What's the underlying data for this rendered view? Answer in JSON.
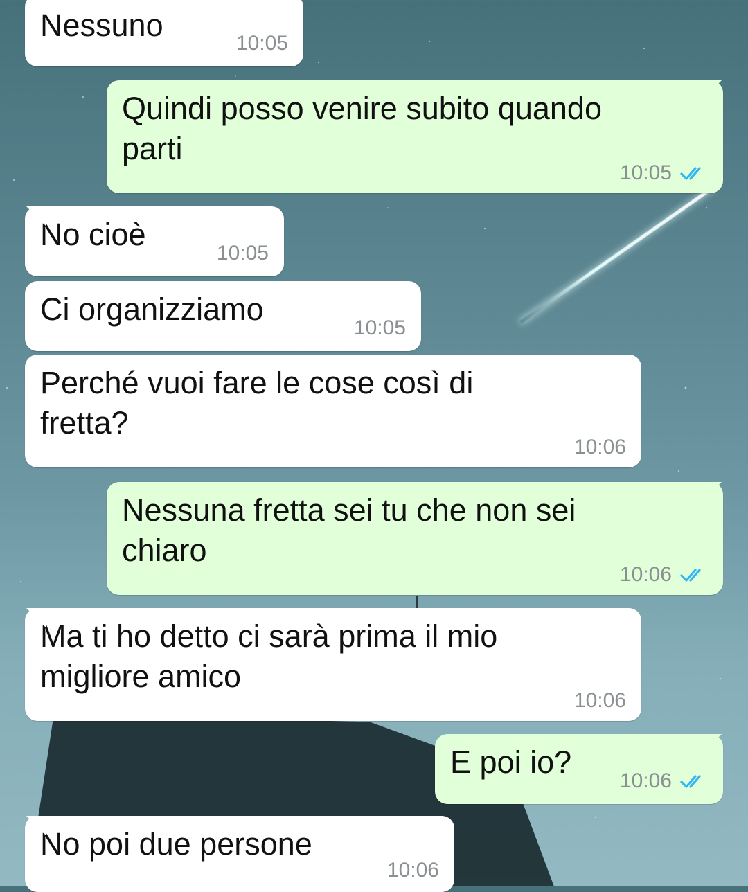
{
  "chat": {
    "messages": [
      {
        "id": "m0",
        "direction": "incoming",
        "text": "Nessuno",
        "time": "10:05",
        "read": false
      },
      {
        "id": "m1",
        "direction": "outgoing",
        "text": "Quindi posso venire subito quando parti",
        "time": "10:05",
        "read": true
      },
      {
        "id": "m2",
        "direction": "incoming",
        "text": "No cioè",
        "time": "10:05",
        "read": false
      },
      {
        "id": "m3",
        "direction": "incoming",
        "text": "Ci organizziamo",
        "time": "10:05",
        "read": false
      },
      {
        "id": "m4",
        "direction": "incoming",
        "text": "Perché vuoi fare le cose così di fretta?",
        "time": "10:06",
        "read": false
      },
      {
        "id": "m5",
        "direction": "outgoing",
        "text": "Nessuna fretta sei tu che non sei chiaro",
        "time": "10:06",
        "read": true
      },
      {
        "id": "m6",
        "direction": "incoming",
        "text": "Ma ti ho detto ci sarà prima il mio migliore amico",
        "time": "10:06",
        "read": false
      },
      {
        "id": "m7",
        "direction": "outgoing",
        "text": "E poi io?",
        "time": "10:06",
        "read": true
      },
      {
        "id": "m8",
        "direction": "incoming",
        "text": "No poi due persone",
        "time": "10:06",
        "read": false
      }
    ]
  },
  "theme": {
    "incoming_bg": "#ffffff",
    "outgoing_bg": "#e1ffd8",
    "time_color": "#8a8f91",
    "read_tick_color": "#34b7f1",
    "text_color": "#111111"
  },
  "icons": {
    "read_ticks": "double-check-icon"
  }
}
